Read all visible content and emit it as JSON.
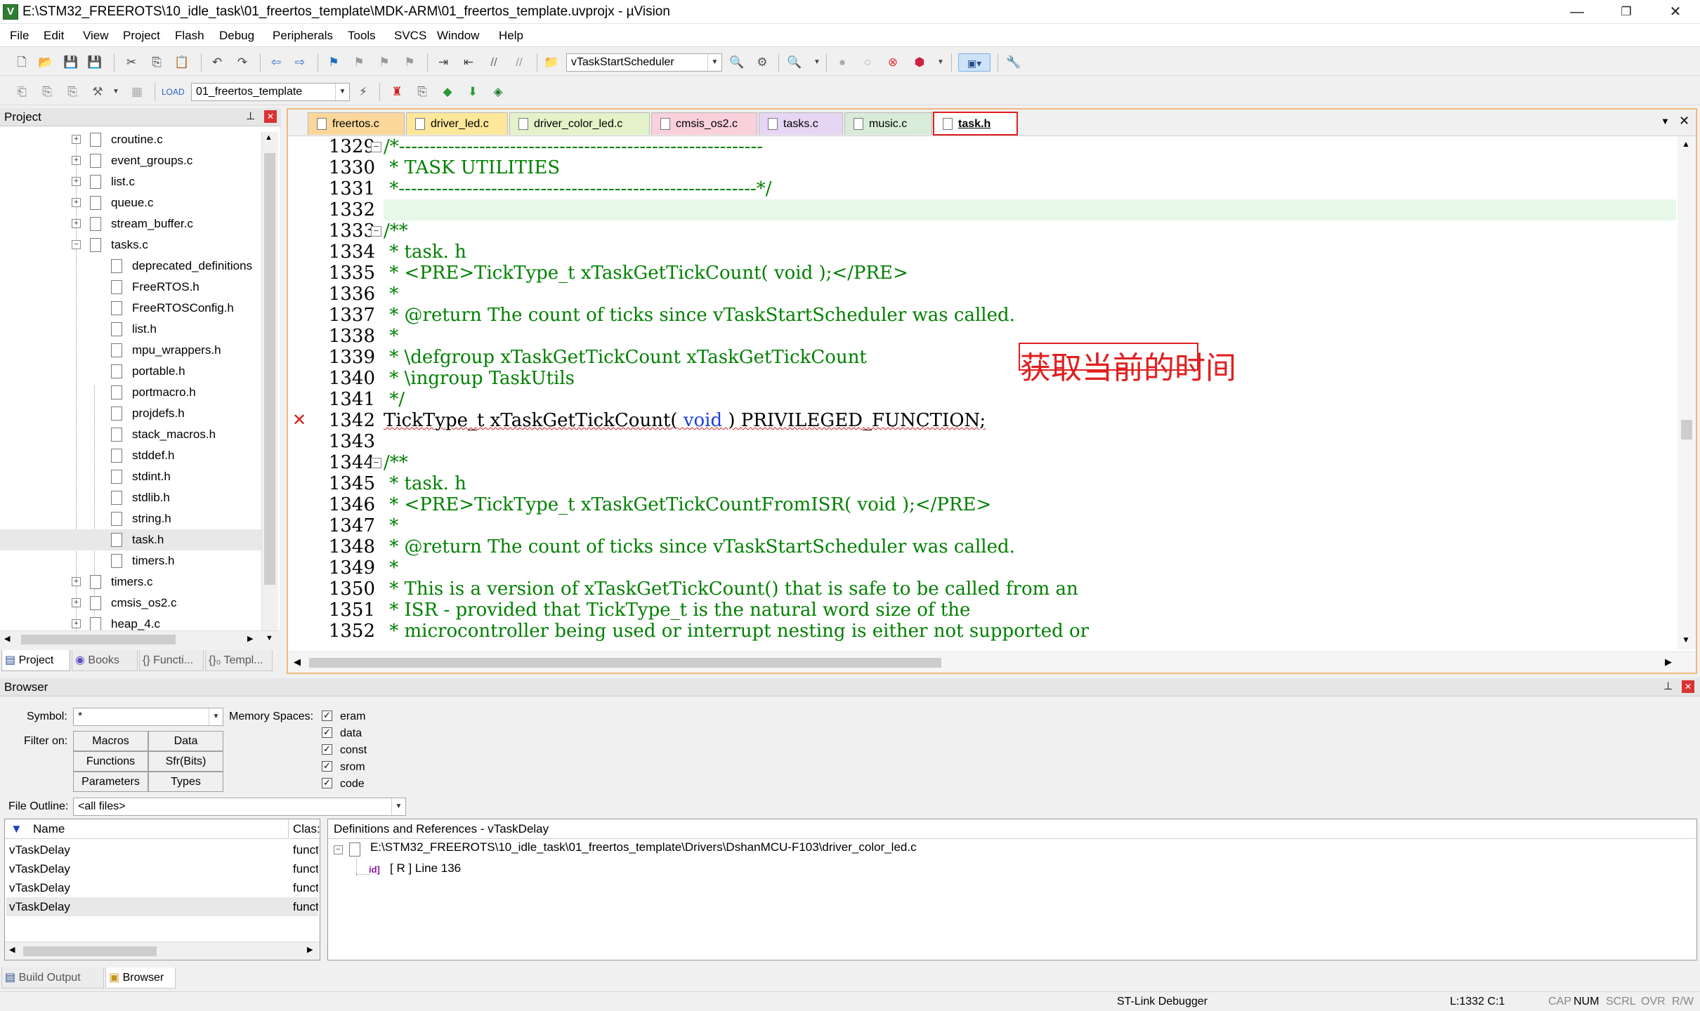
{
  "window": {
    "title": "E:\\STM32_FREEROTS\\10_idle_task\\01_freertos_template\\MDK-ARM\\01_freertos_template.uvprojx - µVision",
    "minimize": "—",
    "restore": "❐",
    "close": "✕"
  },
  "menu": [
    "File",
    "Edit",
    "View",
    "Project",
    "Flash",
    "Debug",
    "Peripherals",
    "Tools",
    "SVCS",
    "Window",
    "Help"
  ],
  "toolbar": {
    "function_combo": "vTaskStartScheduler",
    "target_combo": "01_freertos_template"
  },
  "project_panel": {
    "title": "Project",
    "pin": "⊥",
    "close": "✕",
    "tree": [
      {
        "label": "croutine.c",
        "level": 0,
        "expandable": true
      },
      {
        "label": "event_groups.c",
        "level": 0,
        "expandable": true
      },
      {
        "label": "list.c",
        "level": 0,
        "expandable": true
      },
      {
        "label": "queue.c",
        "level": 0,
        "expandable": true
      },
      {
        "label": "stream_buffer.c",
        "level": 0,
        "expandable": true
      },
      {
        "label": "tasks.c",
        "level": 0,
        "expandable": true,
        "expanded": true
      },
      {
        "label": "deprecated_definitions",
        "level": 1
      },
      {
        "label": "FreeRTOS.h",
        "level": 1
      },
      {
        "label": "FreeRTOSConfig.h",
        "level": 1
      },
      {
        "label": "list.h",
        "level": 1
      },
      {
        "label": "mpu_wrappers.h",
        "level": 1
      },
      {
        "label": "portable.h",
        "level": 1
      },
      {
        "label": "portmacro.h",
        "level": 1
      },
      {
        "label": "projdefs.h",
        "level": 1
      },
      {
        "label": "stack_macros.h",
        "level": 1
      },
      {
        "label": "stddef.h",
        "level": 1
      },
      {
        "label": "stdint.h",
        "level": 1
      },
      {
        "label": "stdlib.h",
        "level": 1
      },
      {
        "label": "string.h",
        "level": 1
      },
      {
        "label": "task.h",
        "level": 1,
        "selected": true
      },
      {
        "label": "timers.h",
        "level": 1
      },
      {
        "label": "timers.c",
        "level": 0,
        "expandable": true
      },
      {
        "label": "cmsis_os2.c",
        "level": 0,
        "expandable": true
      },
      {
        "label": "heap_4.c",
        "level": 0,
        "expandable": true
      }
    ],
    "tabs": [
      "Project",
      "Books",
      "{} Functi...",
      "{}₀ Templ..."
    ]
  },
  "editor": {
    "tabs": [
      {
        "label": "freertos.c",
        "color": "#fcd79a"
      },
      {
        "label": "driver_led.c",
        "color": "#fde79a"
      },
      {
        "label": "driver_color_led.c",
        "color": "#e3f2c9"
      },
      {
        "label": "cmsis_os2.c",
        "color": "#f9d0dc"
      },
      {
        "label": "tasks.c",
        "color": "#e7d6f3"
      },
      {
        "label": "music.c",
        "color": "#d8ecd9"
      },
      {
        "label": "task.h",
        "color": "#fbe1c6",
        "active": true
      }
    ],
    "lines": [
      {
        "n": "1329",
        "text": "/*-----------------------------------------------------------",
        "fold": true
      },
      {
        "n": "1330",
        "text": " * TASK UTILITIES"
      },
      {
        "n": "1331",
        "text": " *----------------------------------------------------------*/"
      },
      {
        "n": "1332",
        "text": "",
        "current": true
      },
      {
        "n": "1333",
        "text": "/**",
        "fold": true
      },
      {
        "n": "1334",
        "text": " * task. h"
      },
      {
        "n": "1335",
        "text": " * <PRE>TickType_t xTaskGetTickCount( void );</PRE>"
      },
      {
        "n": "1336",
        "text": " *"
      },
      {
        "n": "1337",
        "text": " * @return The count of ticks since vTaskStartScheduler was called."
      },
      {
        "n": "1338",
        "text": " *"
      },
      {
        "n": "1339",
        "text": " * \\defgroup xTaskGetTickCount xTaskGetTickCount"
      },
      {
        "n": "1340",
        "text": " * \\ingroup TaskUtils"
      },
      {
        "n": "1341",
        "text": " */"
      },
      {
        "n": "1342",
        "text": "TickType_t xTaskGetTickCount( void ) PRIVILEGED_FUNCTION;",
        "error": true
      },
      {
        "n": "1343",
        "text": ""
      },
      {
        "n": "1344",
        "text": "/**",
        "fold": true
      },
      {
        "n": "1345",
        "text": " * task. h"
      },
      {
        "n": "1346",
        "text": " * <PRE>TickType_t xTaskGetTickCountFromISR( void );</PRE>"
      },
      {
        "n": "1347",
        "text": " *"
      },
      {
        "n": "1348",
        "text": " * @return The count of ticks since vTaskStartScheduler was called."
      },
      {
        "n": "1349",
        "text": " *"
      },
      {
        "n": "1350",
        "text": " * This is a version of xTaskGetTickCount() that is safe to be called from an"
      },
      {
        "n": "1351",
        "text": " * ISR - provided that TickType_t is the natural word size of the"
      },
      {
        "n": "1352",
        "text": " * microcontroller being used or interrupt nesting is either not supported or"
      }
    ],
    "annotation": "获取当前的时间"
  },
  "browser": {
    "title": "Browser",
    "symbol_label": "Symbol:",
    "symbol_value": "*",
    "memory_label": "Memory Spaces:",
    "memory_spaces": [
      "eram",
      "data",
      "const",
      "srom",
      "code"
    ],
    "filter_label": "Filter on:",
    "filters": [
      "Macros",
      "Data",
      "Functions",
      "Sfr(Bits)",
      "Parameters",
      "Types"
    ],
    "outline_label": "File Outline:",
    "outline_value": "<all files>",
    "col_name": "Name",
    "col_class": "Clas:",
    "rows": [
      {
        "name": "vTaskDelay",
        "class": "funct"
      },
      {
        "name": "vTaskDelay",
        "class": "funct"
      },
      {
        "name": "vTaskDelay",
        "class": "funct"
      },
      {
        "name": "vTaskDelay",
        "class": "funct"
      }
    ],
    "defs_header": "Definitions and References - vTaskDelay",
    "def_file": "E:\\STM32_FREEROTS\\10_idle_task\\01_freertos_template\\Drivers\\DshanMCU-F103\\driver_color_led.c",
    "def_ref": "[ R ] Line 136"
  },
  "bottom_tabs": [
    "Build Output",
    "Browser"
  ],
  "status": {
    "debugger": "ST-Link Debugger",
    "position": "L:1332 C:1",
    "cap": "CAP",
    "num": "NUM",
    "scrl": "SCRL",
    "ovr": "OVR",
    "rw": "R/W"
  }
}
